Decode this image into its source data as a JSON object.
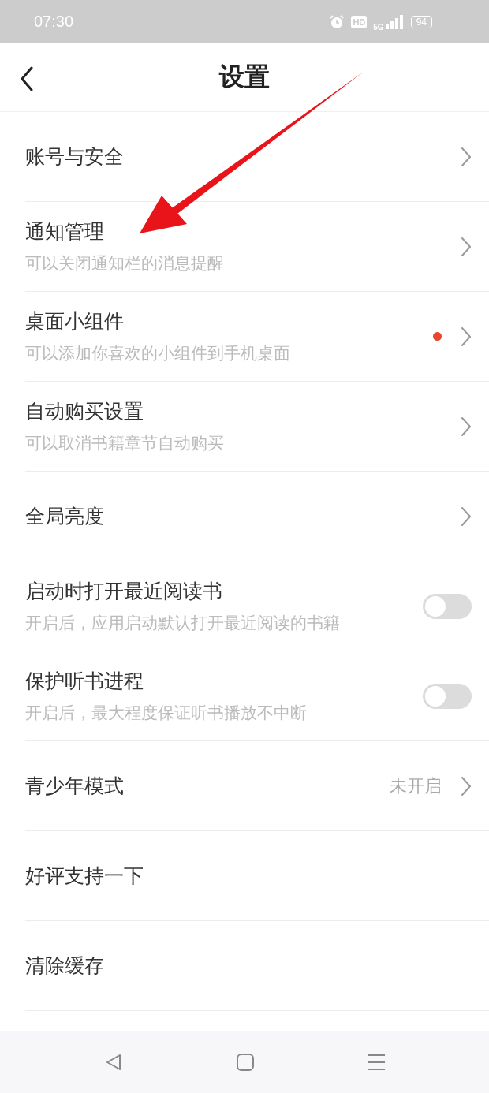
{
  "status_bar": {
    "time": "07:30",
    "hd": "HD",
    "network": "5G",
    "battery": "94"
  },
  "header": {
    "title": "设置"
  },
  "settings": [
    {
      "kind": "link",
      "title": "账号与安全",
      "badge": false
    },
    {
      "kind": "link",
      "title": "通知管理",
      "subtitle": "可以关闭通知栏的消息提醒",
      "badge": false
    },
    {
      "kind": "link",
      "title": "桌面小组件",
      "subtitle": "可以添加你喜欢的小组件到手机桌面",
      "badge": true
    },
    {
      "kind": "link",
      "title": "自动购买设置",
      "subtitle": "可以取消书籍章节自动购买",
      "badge": false
    },
    {
      "kind": "link",
      "title": "全局亮度",
      "badge": false
    },
    {
      "kind": "toggle",
      "title": "启动时打开最近阅读书",
      "subtitle": "开启后，应用启动默认打开最近阅读的书籍",
      "on": false
    },
    {
      "kind": "toggle",
      "title": "保护听书进程",
      "subtitle": "开启后，最大程度保证听书播放不中断",
      "on": false
    },
    {
      "kind": "link",
      "title": "青少年模式",
      "value": "未开启",
      "badge": false
    },
    {
      "kind": "plain",
      "title": "好评支持一下"
    },
    {
      "kind": "plain",
      "title": "清除缓存"
    }
  ],
  "annotation": {
    "kind": "arrow"
  }
}
